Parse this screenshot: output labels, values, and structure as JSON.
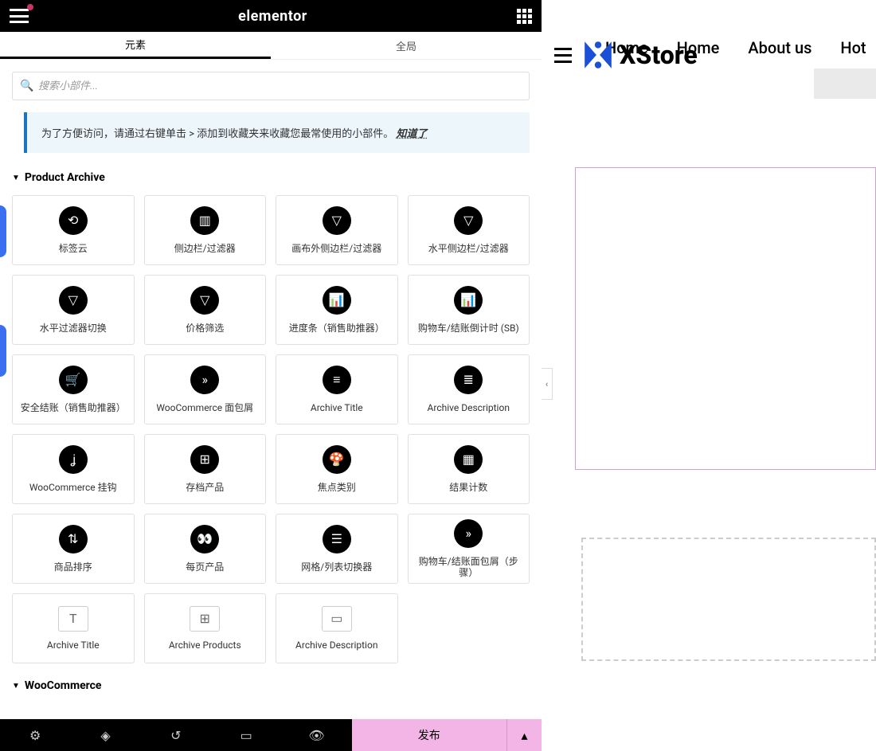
{
  "topbar": {
    "brand": "elementor"
  },
  "tabs": {
    "elements": "元素",
    "global": "全局"
  },
  "search": {
    "placeholder": "搜索小部件..."
  },
  "tip": {
    "text": "为了方便访问，请通过右键单击 > 添加到收藏夹来收藏您最常使用的小部件。",
    "know": "知道了"
  },
  "sections": {
    "productArchive": "Product Archive",
    "woocommerce": "WooCommerce"
  },
  "widgets": {
    "productArchive": [
      {
        "icon": "share",
        "label": "标签云"
      },
      {
        "icon": "sidebar",
        "label": "侧边栏/过滤器"
      },
      {
        "icon": "filter-canvas",
        "label": "画布外侧边栏/过滤器"
      },
      {
        "icon": "filter-horiz",
        "label": "水平侧边栏/过滤器"
      },
      {
        "icon": "filter-toggle",
        "label": "水平过滤器切换"
      },
      {
        "icon": "price",
        "label": "价格筛选"
      },
      {
        "icon": "progress",
        "label": "进度条（销售助推器）"
      },
      {
        "icon": "countdown",
        "label": "购物车/结账倒计时 (SB)"
      },
      {
        "icon": "secure",
        "label": "安全结账（销售助推器）"
      },
      {
        "icon": "breadcrumb",
        "label": "WooCommerce 面包屑"
      },
      {
        "icon": "title",
        "label": "Archive Title"
      },
      {
        "icon": "desc",
        "label": "Archive Description"
      },
      {
        "icon": "hook",
        "label": "WooCommerce 挂钩"
      },
      {
        "icon": "archive-prod",
        "label": "存档产品"
      },
      {
        "icon": "focus-cat",
        "label": "焦点类别"
      },
      {
        "icon": "result",
        "label": "结果计数"
      },
      {
        "icon": "sort",
        "label": "商品排序"
      },
      {
        "icon": "perpage",
        "label": "每页产品"
      },
      {
        "icon": "gridlist",
        "label": "网格/列表切换器"
      },
      {
        "icon": "cart-bread",
        "label": "购物车/结账面包屑（步骤）"
      },
      {
        "icon": "light-title",
        "label": "Archive Title",
        "light": true
      },
      {
        "icon": "light-products",
        "label": "Archive Products",
        "light": true
      },
      {
        "icon": "light-desc",
        "label": "Archive Description",
        "light": true
      }
    ]
  },
  "bottombar": {
    "publish": "发布"
  },
  "preview": {
    "logo": "XStore",
    "nav": [
      "Home",
      "Home",
      "About us",
      "Hot"
    ]
  }
}
